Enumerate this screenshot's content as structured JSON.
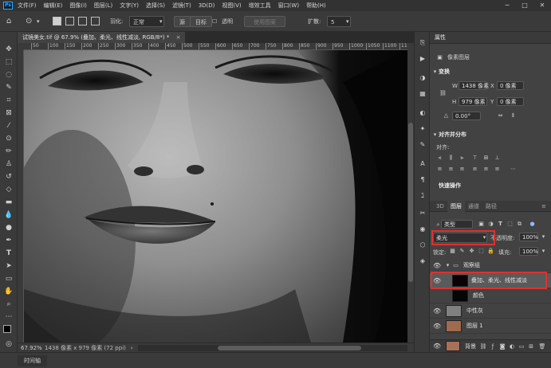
{
  "app": {
    "logo_text": "Ps"
  },
  "menu": [
    "文件(F)",
    "编辑(E)",
    "图像(I)",
    "图层(L)",
    "文字(Y)",
    "选择(S)",
    "滤镜(T)",
    "3D(D)",
    "视图(V)",
    "增效工具",
    "窗口(W)",
    "帮助(H)"
  ],
  "window_controls": {
    "minimize": "─",
    "maximize": "□",
    "close": "✕"
  },
  "options_bar": {
    "feather_label": "羽化:",
    "feather_value": "正常",
    "source_label": "源",
    "target_label": "目标",
    "transparent_label": "透明",
    "use_pattern_label": "使用图案",
    "diffusion_label": "扩散:",
    "diffusion_value": "5"
  },
  "document_tab": {
    "title": "试镜美女.tif @ 67.9% (叠加、柔光、线性减淡, RGB/8*) *",
    "close": "×"
  },
  "ruler": {
    "ticks": [
      "50",
      "100",
      "150",
      "200",
      "250",
      "300",
      "350",
      "400",
      "450",
      "500",
      "550",
      "600",
      "650",
      "700",
      "750",
      "800",
      "850",
      "900",
      "950",
      "1000",
      "1050",
      "1100",
      "1150"
    ]
  },
  "status_bar": {
    "zoom": "67.92%",
    "doc_info": "1438 像素 x 979 像素 (72 ppi)",
    "arrow": "›"
  },
  "timeline": {
    "label": "时间轴"
  },
  "properties_panel": {
    "title": "属性",
    "subtitle": "像素图层",
    "transform_title": "变换",
    "w_label": "W",
    "w_value": "1438 像素",
    "h_label": "H",
    "h_value": "979 像素",
    "x_label": "X",
    "x_value": "0 像素",
    "y_label": "Y",
    "y_value": "0 像素",
    "angle_value": "0.00°",
    "align_title": "对齐并分布",
    "align_sub": "对齐:",
    "quick_title": "快速操作"
  },
  "layers_panel": {
    "tabs": [
      "3D",
      "图层",
      "通道",
      "路径"
    ],
    "active_tab": "图层",
    "filter_label": "类型",
    "blend_mode": "柔光",
    "opacity_label": "不透明度:",
    "opacity_value": "100%",
    "lock_label": "锁定:",
    "fill_label": "填充:",
    "fill_value": "100%",
    "layers": [
      {
        "name": "观察组",
        "type": "group",
        "visible": true
      },
      {
        "name": "叠加、柔光、线性减淡",
        "type": "pixel",
        "visible": true,
        "selected": true,
        "thumb_color": "#0a0305"
      },
      {
        "name": "颜色",
        "type": "pixel",
        "visible": false,
        "thumb_color": "#060606"
      },
      {
        "name": "中性灰",
        "type": "pixel",
        "visible": true,
        "thumb_color": "#808080"
      },
      {
        "name": "图层 1",
        "type": "pixel",
        "visible": true,
        "thumb_color": "#a06a4e"
      },
      {
        "name": "背景",
        "type": "background",
        "visible": true,
        "thumb_color": "#a87058"
      }
    ]
  },
  "colors": {
    "highlight": "#e03030",
    "selected_layer": "#5a5a5a",
    "accent": "#31a8ff"
  }
}
